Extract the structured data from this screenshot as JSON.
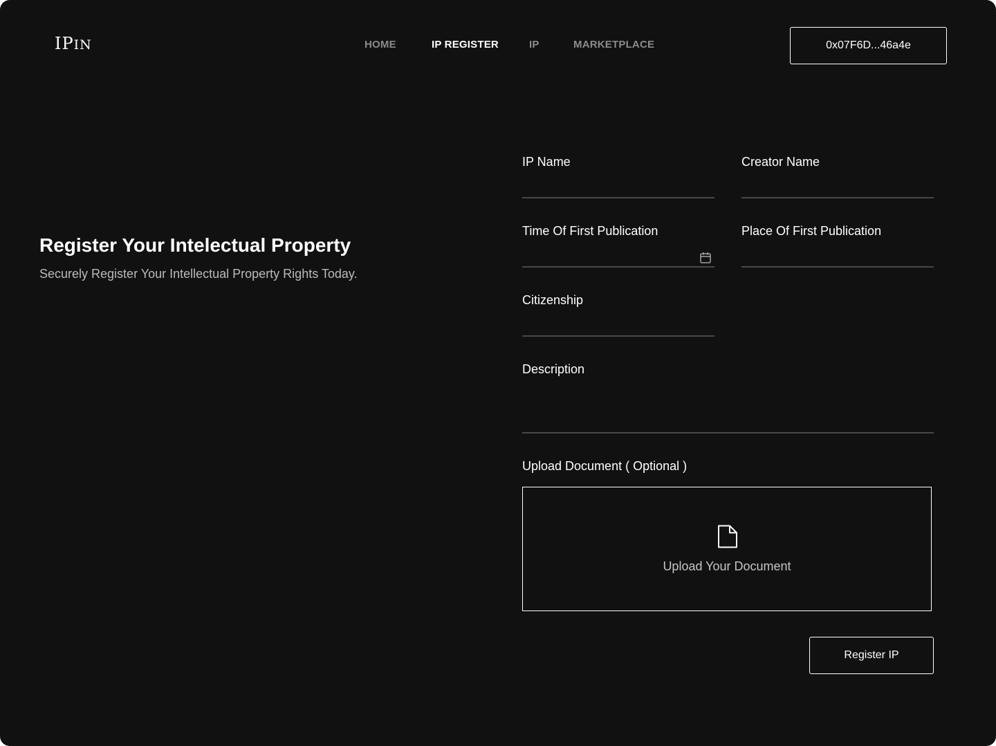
{
  "brand": {
    "logo_text": "IPin"
  },
  "nav": {
    "items": [
      {
        "label": "HOME",
        "active": false
      },
      {
        "label": "IP REGISTER",
        "active": true
      },
      {
        "label": "IP",
        "active": false
      },
      {
        "label": "MARKETPLACE",
        "active": false
      }
    ]
  },
  "wallet": {
    "address": "0x07F6D...46a4e"
  },
  "hero": {
    "title": "Register Your Intelectual Property",
    "subtitle": "Securely Register Your Intellectual Property Rights Today."
  },
  "form": {
    "ip_name": {
      "label": "IP Name",
      "value": ""
    },
    "creator_name": {
      "label": "Creator Name",
      "value": ""
    },
    "time_of_first_publication": {
      "label": "Time Of First Publication",
      "value": "",
      "icon": "calendar-icon"
    },
    "place_of_first_publication": {
      "label": "Place Of First Publication",
      "value": ""
    },
    "citizenship": {
      "label": "Citizenship",
      "value": ""
    },
    "description": {
      "label": "Description",
      "value": ""
    },
    "upload": {
      "label": "Upload Document ( Optional )",
      "prompt": "Upload Your Document",
      "icon": "document-icon"
    },
    "submit_label": "Register IP"
  },
  "colors": {
    "background": "#121112",
    "text": "#ffffff",
    "muted_nav": "#8d8a8a",
    "subtitle": "#bdbabb",
    "input_underline": "#4a4748"
  }
}
